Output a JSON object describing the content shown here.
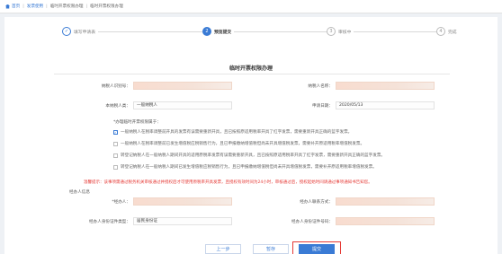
{
  "breadcrumb": {
    "items": [
      "首页",
      "发票使用",
      "临时开票权限办理",
      "临时开票权限办理"
    ]
  },
  "steps": [
    {
      "num": "✓",
      "label": "填写申请表",
      "state": "done"
    },
    {
      "num": "2",
      "label": "预览提交",
      "state": "active"
    },
    {
      "num": "3",
      "label": "审核中",
      "state": "todo"
    },
    {
      "num": "4",
      "label": "完成",
      "state": "todo"
    }
  ],
  "form": {
    "title": "临时开票权限办理",
    "taxpayer_id_label": "纳税人识别号：",
    "taxpayer_name_label": "纳税人名称：",
    "taxpayer_type_label": "本纳税人类：",
    "taxpayer_type_value": "一般纳税人",
    "apply_date_label": "申请日期：",
    "apply_date_value": "2020/05/13",
    "checkbox_title": "*办理临时开票权限属于：",
    "checkboxes": [
      "一般纳税人在税率调整前开具的发票有误需要重新开具，且已按照原适用税率开具了红字发票，需要重新开具正确的蓝字发票。",
      "一般纳税人在税率调整前已发生增值税应税销售行为，且已申报缴纳增值税但尚未开具增值税发票，需要补开原适用税率增值税发票。",
      "转登记纳税人在一般纳税人期间开具的适用原税率发票有误需要重新开具，且已按照原适用税率开具了红字发票，需要重新开具正确的蓝字发票。",
      "转登记纳税人在一般纳税人期间已发生增值税应税销售行为，且已申报缴纳增值税但尚未开具增值税发票，需要补开原适用税率增值税发票。"
    ],
    "warning": "温馨提示：该事项需通过税务机关审核通过并授权后才可使用原税率开具发票，且授权有效时间为24小时，审核通过后，授权起始时间请通过事项通知书告知您。",
    "handler_section": "经办人信息",
    "handler_label": "*经办人：",
    "handler_contact_label": "经办人联系方式：",
    "id_type_label": "经办人身份证件类型：",
    "id_type_value": "居民身份证",
    "id_number_label": "经办人身份证件号码："
  },
  "buttons": {
    "prev": "上一步",
    "save": "暂存",
    "submit": "提交"
  },
  "colors": {
    "accent": "#3a7bd5",
    "warning": "#e53935"
  }
}
